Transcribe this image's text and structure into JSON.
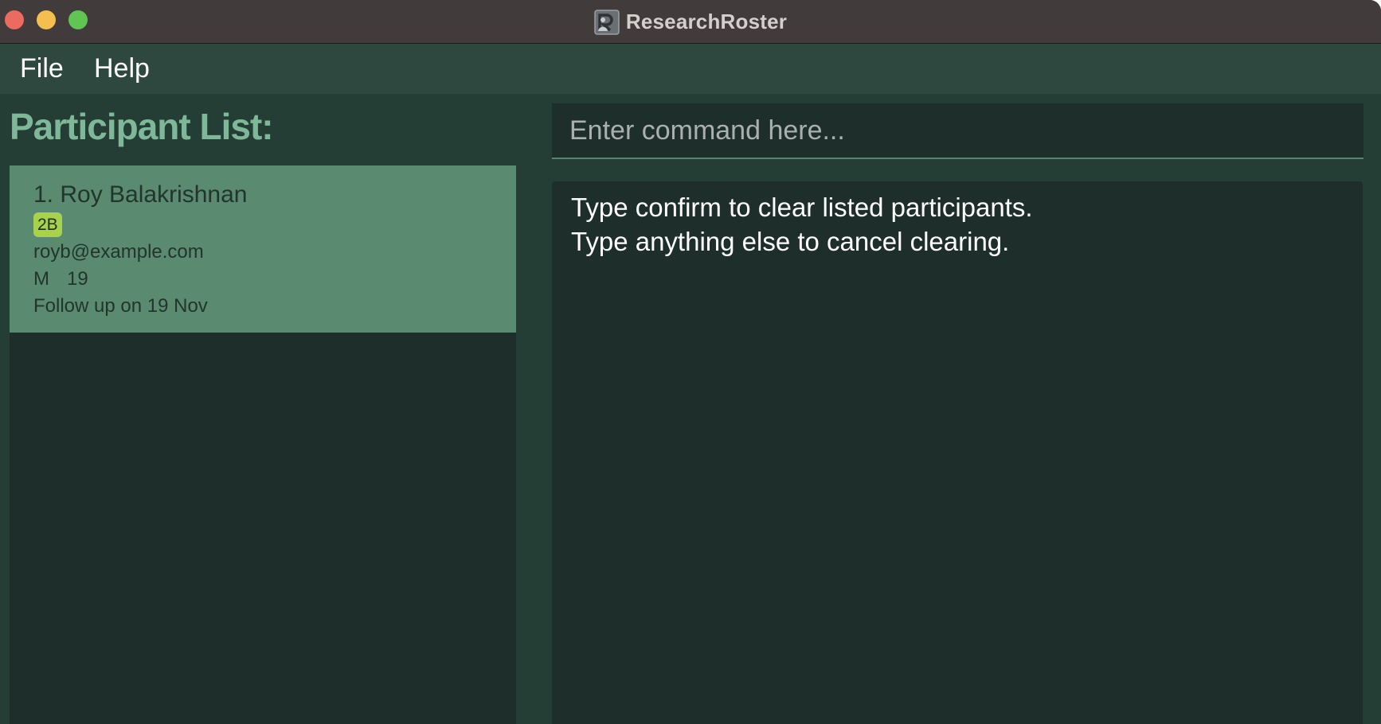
{
  "window": {
    "title": "ResearchRoster",
    "app_icon": "research-roster-logo-icon",
    "traffic_lights": [
      "close",
      "minimize",
      "maximize"
    ]
  },
  "menu": {
    "items": [
      {
        "label": "File"
      },
      {
        "label": "Help"
      }
    ]
  },
  "participant_list": {
    "title": "Participant List:",
    "participants": [
      {
        "name": "1. Roy Balakrishnan",
        "tag": "2B",
        "email": "royb@example.com",
        "gender": "M",
        "age": "19",
        "note": "Follow up on 19 Nov"
      }
    ]
  },
  "command": {
    "placeholder": "Enter command here...",
    "value": ""
  },
  "result": {
    "lines": [
      "Type confirm to clear listed participants.",
      "Type anything else to cancel clearing."
    ]
  },
  "colors": {
    "titlebar": "#413b3c",
    "menubar": "#2e473f",
    "background": "#243d35",
    "panel": "#1e2e2a",
    "card_selected": "#5a8a6f",
    "heading": "#7fb899",
    "tag": "#a8d24a",
    "close": "#ec6a5f",
    "minimize": "#f4bf4f",
    "maximize": "#61c554"
  }
}
